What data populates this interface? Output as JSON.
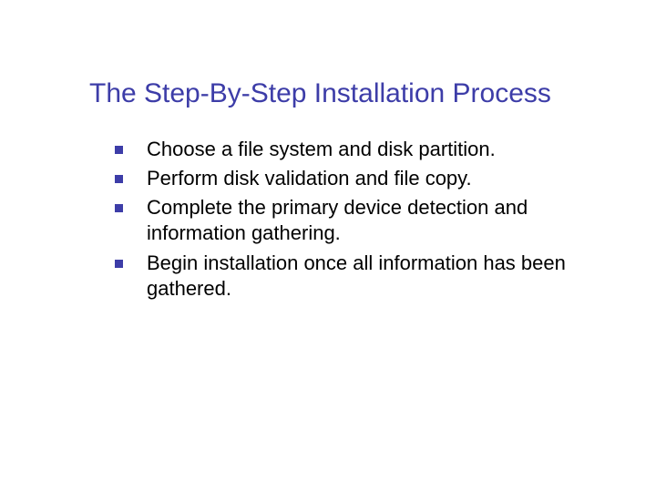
{
  "slide": {
    "title": "The Step-By-Step Installation Process",
    "bullets": [
      {
        "text": "Choose a file system and disk partition."
      },
      {
        "text": "Perform disk validation and file copy."
      },
      {
        "text": "Complete the primary device detection and information gathering."
      },
      {
        "text": "Begin installation once all information has been gathered."
      }
    ]
  }
}
